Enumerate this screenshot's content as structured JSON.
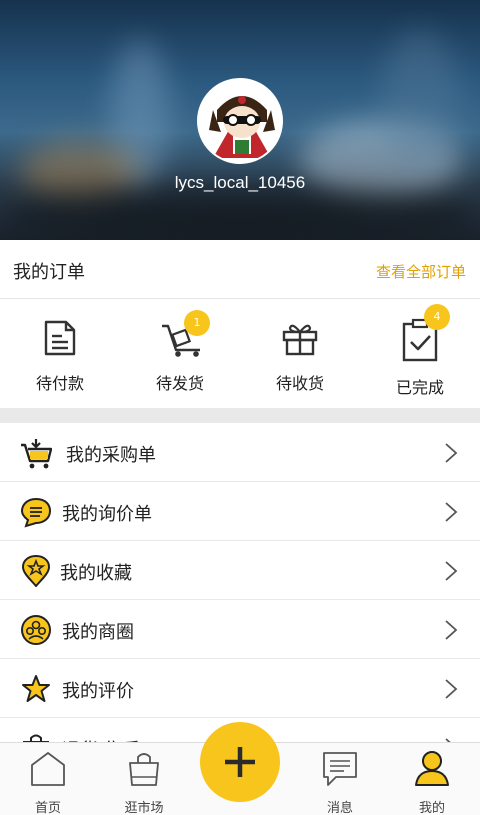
{
  "profile": {
    "username": "lycs_local_10456"
  },
  "orders": {
    "title": "我的订单",
    "view_all": "查看全部订单",
    "items": [
      {
        "label": "待付款",
        "icon": "document-icon",
        "badge": ""
      },
      {
        "label": "待发货",
        "icon": "cart-trolley-icon",
        "badge": "1"
      },
      {
        "label": "待收货",
        "icon": "gift-icon",
        "badge": ""
      },
      {
        "label": "已完成",
        "icon": "clipboard-check-icon",
        "badge": "4"
      }
    ]
  },
  "menu": [
    {
      "label": "我的采购单",
      "icon": "shopping-cart-icon"
    },
    {
      "label": "我的询价单",
      "icon": "chat-bubble-icon"
    },
    {
      "label": "我的收藏",
      "icon": "star-pin-icon"
    },
    {
      "label": "我的商圈",
      "icon": "people-circle-icon"
    },
    {
      "label": "我的评价",
      "icon": "star-icon"
    },
    {
      "label": "退货/售后",
      "icon": "bag-icon"
    }
  ],
  "nav": [
    {
      "label": "首页",
      "icon": "home-icon"
    },
    {
      "label": "逛市场",
      "icon": "shopping-bag-icon"
    },
    {
      "label": "消息",
      "icon": "message-icon"
    },
    {
      "label": "我的",
      "icon": "user-icon",
      "active": true
    }
  ],
  "colors": {
    "accent": "#f8c51c",
    "link": "#e0a000"
  }
}
